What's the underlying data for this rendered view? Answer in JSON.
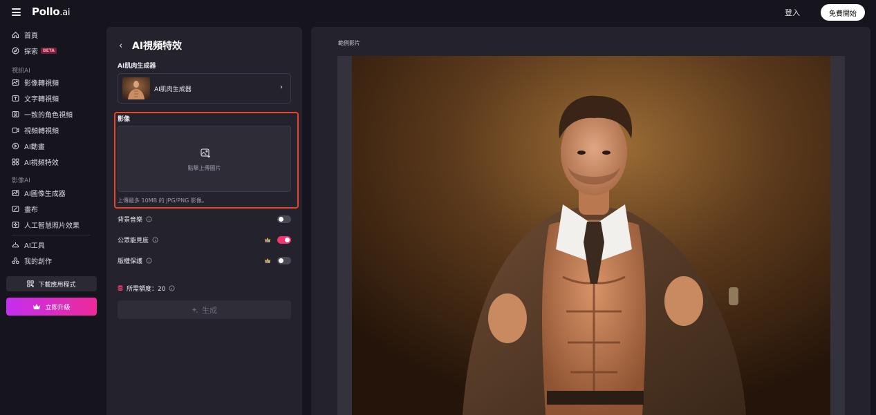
{
  "header": {
    "logo_main": "Pollo",
    "logo_sub": ".ai",
    "login_label": "登入",
    "start_label": "免費開始"
  },
  "sidebar": {
    "home": "首頁",
    "explore": "探索",
    "explore_badge": "BETA",
    "video_section": "視訊AI",
    "video_items": [
      "影像轉視頻",
      "文字轉視頻",
      "一致的角色視頻",
      "視頻轉視頻",
      "AI動畫",
      "AI視頻特效"
    ],
    "image_section": "影像AI",
    "image_items": [
      "AI圖像生成器",
      "畫布",
      "人工智慧照片效果"
    ],
    "tools": "AI工具",
    "my_creations": "我的創作",
    "download_app": "下載應用程式",
    "upgrade": "立即升級"
  },
  "form": {
    "title": "AI視頻特效",
    "effect_label": "AI肌肉生成器",
    "effect_value": "AI肌肉生成器",
    "image_label": "影像",
    "upload_text": "點擊上傳圖片",
    "upload_hint": "上傳最多 10MB 的 JPG/PNG 影像。",
    "bg_music": "背景音樂",
    "public_visibility": "公眾能見度",
    "copyright": "版權保護",
    "credits": "所需額度：20",
    "generate": "生成"
  },
  "preview": {
    "label": "範例影片"
  },
  "colors": {
    "accent": "#f0366f",
    "highlight": "#e8452a",
    "upgrade_start": "#c42ff0",
    "upgrade_end": "#ee2a9a"
  },
  "toggles": {
    "bg_music": false,
    "public_visibility": true,
    "copyright": false
  }
}
